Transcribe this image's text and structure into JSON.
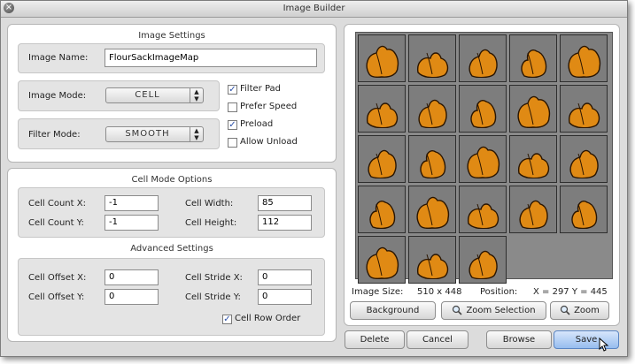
{
  "window": {
    "title": "Image Builder"
  },
  "image_settings": {
    "title": "Image Settings",
    "image_name_label": "Image Name:",
    "image_name_value": "FlourSackImageMap",
    "image_mode_label": "Image Mode:",
    "image_mode_value": "CELL",
    "filter_mode_label": "Filter Mode:",
    "filter_mode_value": "SMOOTH",
    "options": [
      {
        "label": "Filter Pad",
        "checked": true
      },
      {
        "label": "Prefer Speed",
        "checked": false
      },
      {
        "label": "Preload",
        "checked": true
      },
      {
        "label": "Allow Unload",
        "checked": false
      }
    ]
  },
  "cell_mode": {
    "title": "Cell Mode Options",
    "cell_count_x_label": "Cell Count X:",
    "cell_count_x_value": "-1",
    "cell_count_y_label": "Cell Count Y:",
    "cell_count_y_value": "-1",
    "cell_width_label": "Cell Width:",
    "cell_width_value": "85",
    "cell_height_label": "Cell Height:",
    "cell_height_value": "112"
  },
  "advanced": {
    "title": "Advanced Settings",
    "cell_offset_x_label": "Cell Offset X:",
    "cell_offset_x_value": "0",
    "cell_offset_y_label": "Cell Offset Y:",
    "cell_offset_y_value": "0",
    "cell_stride_x_label": "Cell Stride X:",
    "cell_stride_x_value": "0",
    "cell_stride_y_label": "Cell Stride Y:",
    "cell_stride_y_value": "0",
    "cell_row_order_label": "Cell Row Order",
    "cell_row_order_checked": true
  },
  "preview": {
    "cell_count": 23,
    "image_size_label": "Image Size:",
    "image_size_value": "510 x 448",
    "position_label": "Position:",
    "position_value": "X = 297 Y = 445",
    "sack_color": "#e08a14",
    "tile_bg_color": "#7d7d7d"
  },
  "preview_buttons": {
    "background": "Background",
    "zoom_selection": "Zoom Selection",
    "zoom": "Zoom"
  },
  "footer": {
    "delete": "Delete",
    "cancel": "Cancel",
    "browse": "Browse",
    "save": "Save"
  },
  "icons": [
    "close-icon",
    "select-arrows-icon",
    "magnifier-icon",
    "checkmark-icon",
    "flour-sack-sprite"
  ]
}
